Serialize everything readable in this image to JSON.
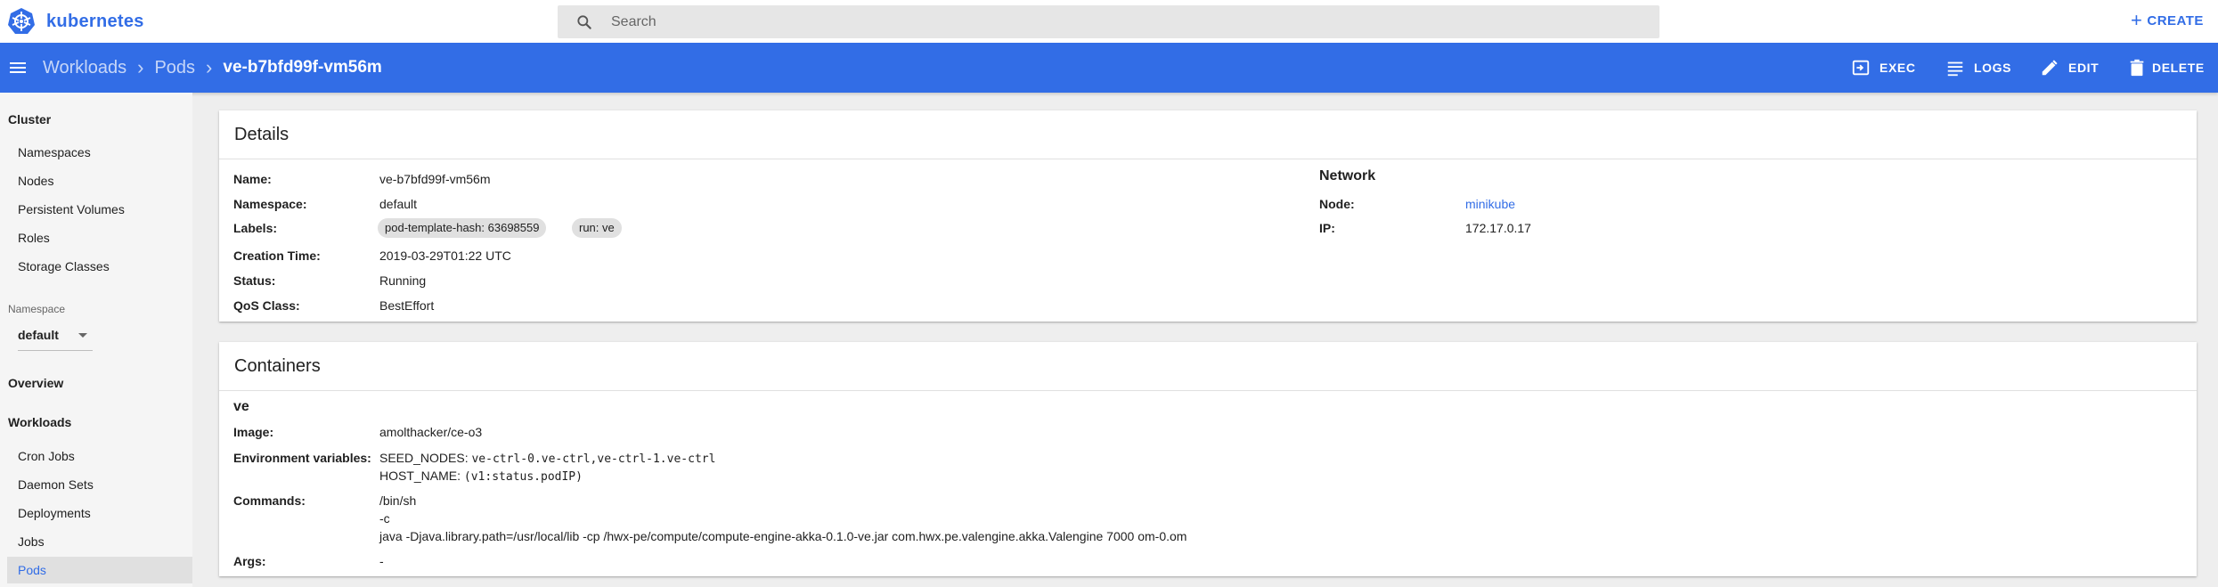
{
  "app": {
    "brand": "kubernetes"
  },
  "search": {
    "placeholder": "Search",
    "value": ""
  },
  "header": {
    "create_label": "CREATE"
  },
  "toolbar": {
    "breadcrumbs": [
      "Workloads",
      "Pods"
    ],
    "current": "ve-b7bfd99f-vm56m",
    "actions": {
      "exec": "EXEC",
      "logs": "LOGS",
      "edit": "EDIT",
      "delete": "DELETE"
    }
  },
  "sidebar": {
    "cluster_header": "Cluster",
    "cluster_items": [
      "Namespaces",
      "Nodes",
      "Persistent Volumes",
      "Roles",
      "Storage Classes"
    ],
    "namespace_label": "Namespace",
    "namespace_value": "default",
    "overview": "Overview",
    "workloads_header": "Workloads",
    "workload_items": [
      "Cron Jobs",
      "Daemon Sets",
      "Deployments",
      "Jobs",
      "Pods"
    ],
    "active_item": "Pods"
  },
  "details": {
    "title": "Details",
    "fields": {
      "name_label": "Name:",
      "name": "ve-b7bfd99f-vm56m",
      "namespace_label": "Namespace:",
      "namespace": "default",
      "labels_label": "Labels:",
      "labels": [
        "pod-template-hash: 63698559",
        "run: ve"
      ],
      "creation_label": "Creation Time:",
      "creation": "2019-03-29T01:22 UTC",
      "status_label": "Status:",
      "status": "Running",
      "qos_label": "QoS Class:",
      "qos": "BestEffort"
    },
    "network": {
      "title": "Network",
      "node_label": "Node:",
      "node": "minikube",
      "ip_label": "IP:",
      "ip": "172.17.0.17"
    }
  },
  "containers": {
    "title": "Containers",
    "name": "ve",
    "image_label": "Image:",
    "image": "amolthacker/ce-o3",
    "env_label": "Environment variables:",
    "env": [
      {
        "key": "SEED_NODES:",
        "value": "ve-ctrl-0.ve-ctrl,ve-ctrl-1.ve-ctrl"
      },
      {
        "key": "HOST_NAME:",
        "value": "(v1:status.podIP)"
      }
    ],
    "commands_label": "Commands:",
    "commands": [
      "/bin/sh",
      "-c",
      "java -Djava.library.path=/usr/local/lib -cp /hwx-pe/compute/compute-engine-akka-0.1.0-ve.jar com.hwx.pe.valengine.akka.Valengine 7000 om-0.om"
    ],
    "args_label": "Args:",
    "args": "-"
  },
  "colors": {
    "brand": "#326de6",
    "toolbar": "#326de6",
    "background": "#eeeeee"
  },
  "icons": [
    "kubernetes-logo",
    "search-icon",
    "plus-icon",
    "menu-icon",
    "chevron-right-icon",
    "exec-icon",
    "logs-icon",
    "edit-icon",
    "delete-icon",
    "caret-down-icon"
  ]
}
